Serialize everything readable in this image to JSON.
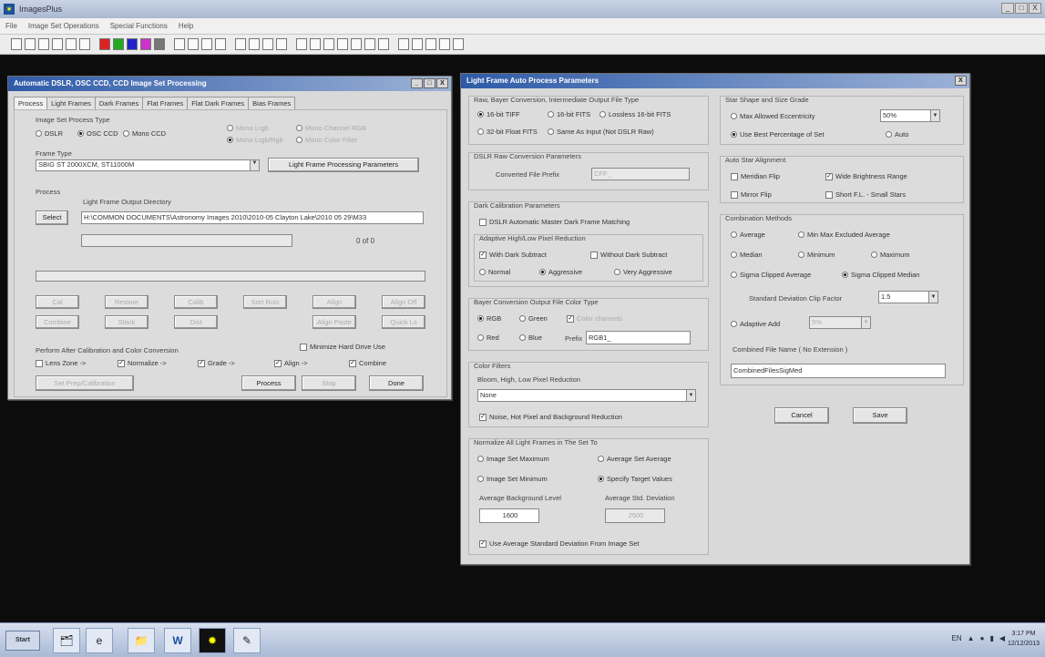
{
  "app": {
    "title": "ImagesPlus",
    "menu": [
      "File",
      "Image Set Operations",
      "Special Functions",
      "Help"
    ],
    "controls": {
      "min": "_",
      "max": "□",
      "close": "X"
    }
  },
  "toolbar": {
    "buttons": [
      "new",
      "open",
      "save",
      "cut",
      "copy",
      "paste",
      "red",
      "green",
      "blue",
      "rgb",
      "gray",
      "undo",
      "redo",
      "rotate-l",
      "rotate-r",
      "zoom-in",
      "zoom-out",
      "crop",
      "level",
      "curves",
      "stretch",
      "hist",
      "sharpen",
      "blur",
      "histogram",
      "color",
      "info",
      "zoom1",
      "zoom2",
      "zoom3",
      "zoom4"
    ]
  },
  "colors": {
    "workspace": "#0c0c0c",
    "dialog_title": "#2e5aa7",
    "dialog_bg": "#d9d9d9"
  },
  "left_dialog": {
    "title": "Automatic DSLR, OSC CCD, CCD Image Set Processing",
    "tabs": [
      "Process",
      "Light Frames",
      "Dark Frames",
      "Flat Frames",
      "Flat Dark Frames",
      "Bias Frames"
    ],
    "image_set_type_label": "Image Set Process Type",
    "types": [
      "DSLR",
      "OSC CCD",
      "Mono CCD"
    ],
    "types_disabled": [
      "Mono Lrgb",
      "Mono Channel RGB",
      "Mono Lrgb/Rgb",
      "Mono Color Filter"
    ],
    "frame_type_label": "Frame Type",
    "frame_type_value": "SBIG ST 2000XCM, ST11000M",
    "lfpp_button": "Light Frame Processing Parameters",
    "process_label": "Process",
    "output_dir_label": "Light Frame Output Directory",
    "select_button": "Select",
    "output_dir_value": "H:\\COMMON DOCUMENTS\\Astronomy Images 2010\\2010-05 Clayton Lake\\2010 05 29\\M33",
    "progress_count": "0  of  0",
    "action_buttons": [
      "Cal",
      "Restore",
      "Calib",
      "Sort Rois",
      "Align",
      "Align Off",
      "Combine",
      "Stack",
      "Dist",
      "",
      "Align Paste",
      "Quick Ls"
    ],
    "perform_label": "Perform After Calibration and Color Conversion",
    "minimize_hd": "Minimize Hard Drive Use",
    "perform_options": [
      "Lens Zone ->",
      "Normalize ->",
      "Grade ->",
      "Align ->",
      "Combine"
    ],
    "perform_checked": [
      false,
      true,
      true,
      true,
      true
    ],
    "review_button": "Set Prep/Calibration",
    "process_button": "Process",
    "stop_button": "Stop",
    "done_button": "Done"
  },
  "right_dialog": {
    "title": "Light Frame Auto Process Parameters",
    "raw_label": "Raw, Bayer Conversion, Intermediate Output File Type",
    "raw_options": [
      "16-bit TIFF",
      "16-bit FITS",
      "Lossless 16-bit FITS",
      "32-bit Float FITS",
      "Same As Input (Not DSLR Raw)"
    ],
    "raw_selected": 0,
    "dslr_label": "DSLR Raw Conversion Parameters",
    "converted_prefix_label": "Converted File Prefix",
    "converted_prefix_value": "CFF_",
    "dark_label": "Dark Calibration Parameters",
    "dslr_auto_dark": "DSLR Automatic Master Dark Frame Matching",
    "hot_pixel_label": "Adaptive High/Low Pixel Reduction",
    "with_dark": "With Dark Subtract",
    "without_dark": "Without Dark Subtract",
    "levels": [
      "Normal",
      "Aggressive",
      "Very Aggressive"
    ],
    "level_selected": 1,
    "bayer_label": "Bayer Conversion Output File Color Type",
    "bayer_options": [
      "RGB",
      "Green",
      "Color channels",
      "Red",
      "Blue"
    ],
    "prefix_label": "Prefix",
    "prefix_value": "RGB1_",
    "color_filters_label": "Color Filters",
    "bloom_label": "Bloom, High, Low Pixel Reduction",
    "bloom_value": "None",
    "noise_check": "Noise, Hot Pixel and Background Reduction",
    "normalize_label": "Normalize All Light Frames in The Set To",
    "normalize_options": [
      "Image Set Maximum",
      "Average Set Average",
      "Image Set Minimum",
      "Specify Target Values"
    ],
    "normalize_selected": 3,
    "avg_bg_label": "Average Background Level",
    "avg_bg_value": "1600",
    "avg_sd_label": "Average Std. Deviation",
    "avg_sd_value": "2500",
    "use_avg_sd": "Use Average Standard Deviation From Image Set",
    "star_label": "Star Shape and Size Grade",
    "max_ecc": "Max Allowed Eccentricity",
    "max_ecc_value": "50%",
    "use_best": "Use Best Percentage of Set",
    "auto": "Auto",
    "auto_align_label": "Auto Star Alignment",
    "meridian_flip": "Meridian Flip",
    "wide_range": "Wide Brightness Range",
    "mirror_flip": "Mirror Flip",
    "short_fl": "Short F.L. - Small Stars",
    "combine_label": "Combination Methods",
    "combine_methods": [
      "Average",
      "Min Max Excluded Average",
      "Median",
      "Minimum",
      "Maximum",
      "Sigma Clipped Average",
      "Sigma Clipped Median"
    ],
    "combine_selected": 6,
    "sd_clip_label": "Standard Deviation Clip Factor",
    "sd_clip_value": "1.5",
    "adaptive_add": "Adaptive Add",
    "adaptive_value": "5%",
    "combined_name_label": "Combined File Name ( No Extension )",
    "combined_name_value": "CombinedFilesSigMed",
    "cancel_button": "Cancel",
    "save_button": "Save"
  },
  "taskbar": {
    "start": "Start",
    "apps": [
      "explorer",
      "ie",
      "folder",
      "word",
      "imagesplus",
      "paint"
    ],
    "tray_lang": "EN",
    "time": "3:17 PM",
    "date": "12/12/2013"
  }
}
